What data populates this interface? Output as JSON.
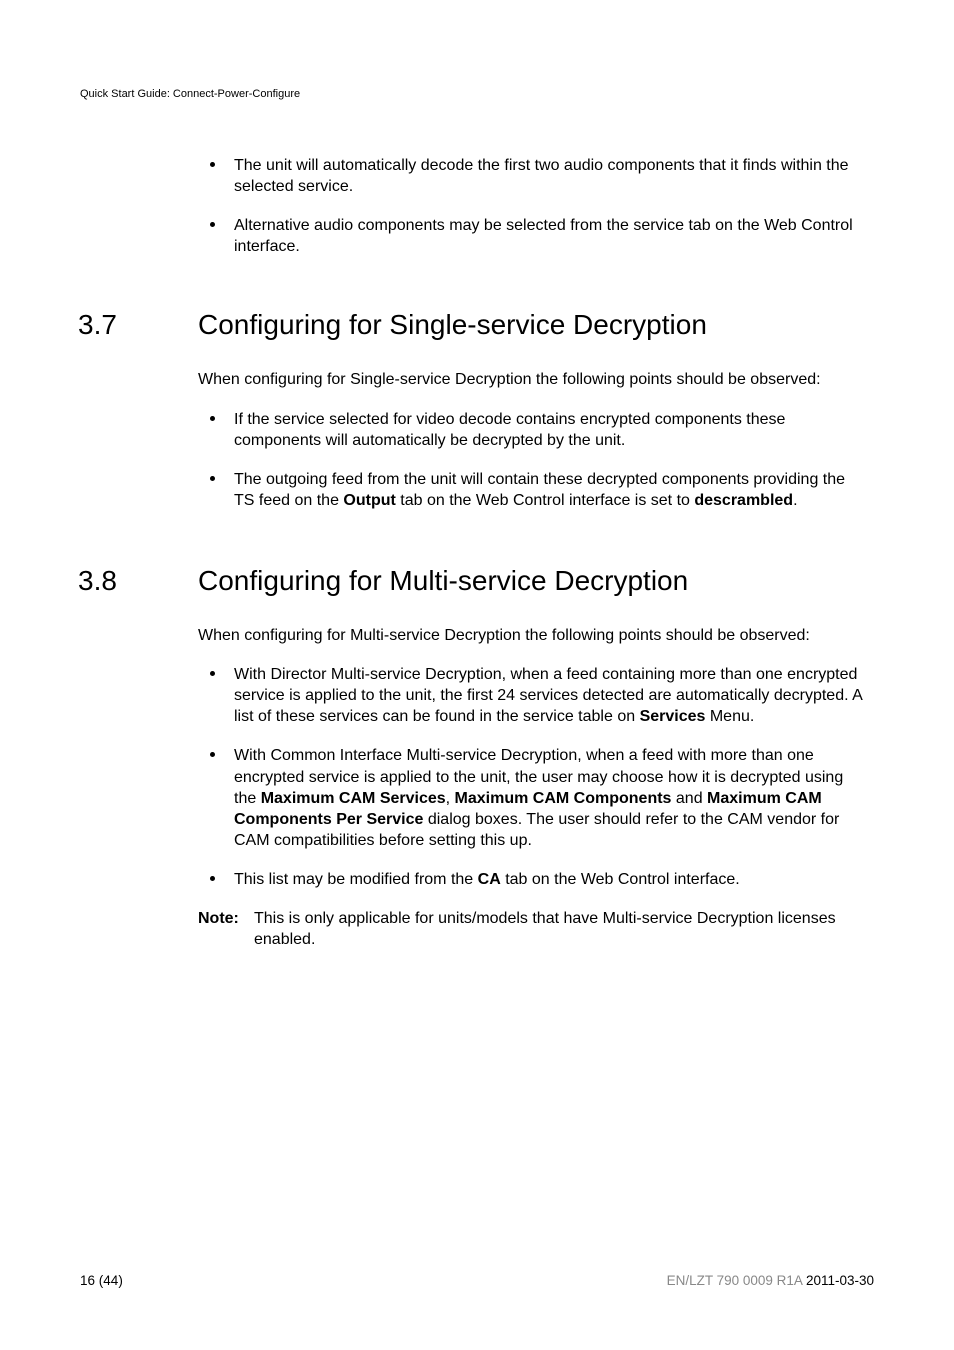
{
  "header": {
    "running_head": "Quick Start Guide: Connect-Power-Configure"
  },
  "prebullets": [
    "The unit will automatically decode the first two audio components that it finds within the selected service.",
    "Alternative audio components may be selected from the service tab on the Web Control interface."
  ],
  "sections": [
    {
      "number": "3.7",
      "title": "Configuring for Single-service Decryption",
      "intro": "When configuring for Single-service Decryption the following points should be observed:",
      "bullets": [
        {
          "text": "If the service selected for video decode contains encrypted components these components will automatically be decrypted by the unit."
        },
        {
          "runs": [
            {
              "t": "The outgoing feed from the unit will contain these decrypted components providing the TS feed on the "
            },
            {
              "t": "Output",
              "b": true
            },
            {
              "t": " tab on the Web Control interface is set to "
            },
            {
              "t": "descrambled",
              "b": true
            },
            {
              "t": "."
            }
          ]
        }
      ]
    },
    {
      "number": "3.8",
      "title": "Configuring for Multi-service Decryption",
      "intro": "When configuring for Multi-service Decryption the following points should be observed:",
      "bullets": [
        {
          "runs": [
            {
              "t": "With Director Multi-service Decryption, when a feed containing more than one encrypted service is applied to the unit, the first 24 services detected are automatically decrypted. A list of these services can be found in the service table on "
            },
            {
              "t": "Services",
              "b": true
            },
            {
              "t": " Menu."
            }
          ]
        },
        {
          "runs": [
            {
              "t": "With Common Interface Multi-service Decryption, when a feed with more than one encrypted service is applied to the unit, the user may choose how it is decrypted using the "
            },
            {
              "t": "Maximum CAM Services",
              "b": true
            },
            {
              "t": ", "
            },
            {
              "t": "Maximum CAM Components",
              "b": true
            },
            {
              "t": " and "
            },
            {
              "t": "Maximum CAM Components Per Service",
              "b": true
            },
            {
              "t": " dialog boxes. The user should refer to the CAM vendor for CAM compatibilities before setting this up."
            }
          ]
        },
        {
          "runs": [
            {
              "t": "This list may be modified from the "
            },
            {
              "t": "CA",
              "b": true
            },
            {
              "t": " tab on the Web Control interface."
            }
          ]
        }
      ],
      "note": {
        "label": "Note:",
        "text": "This is only applicable for units/models that have Multi-service Decryption licenses enabled."
      }
    }
  ],
  "footer": {
    "page_current": "16",
    "page_total": "44",
    "doc_code": "EN/LZT 790 0009 R1A",
    "date": "2011-03-30"
  }
}
